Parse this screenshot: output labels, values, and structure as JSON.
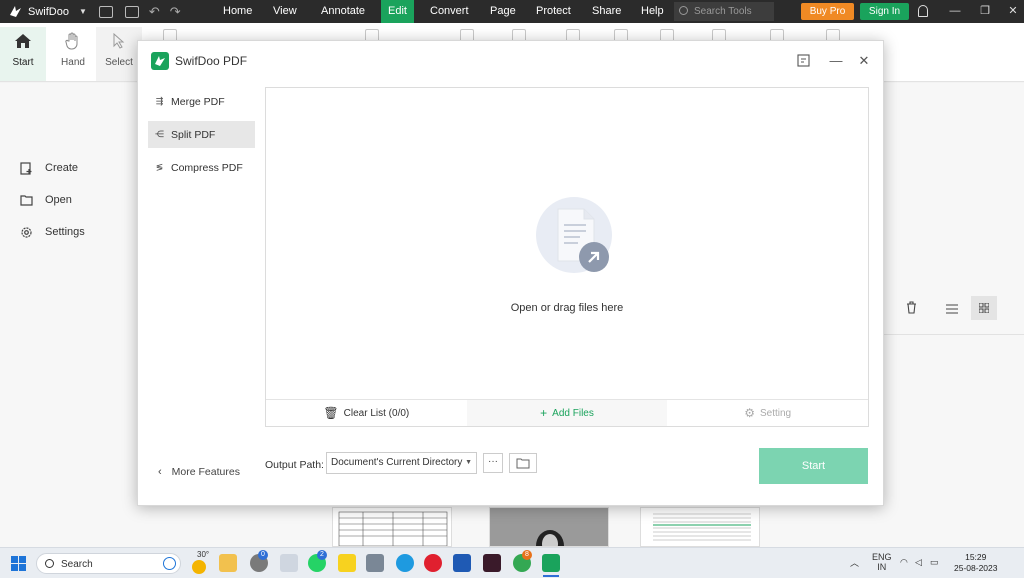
{
  "titlebar": {
    "app_name": "SwifDoo",
    "menus": [
      "Home",
      "View",
      "Annotate",
      "Edit",
      "Convert",
      "Page",
      "Protect",
      "Share",
      "Help"
    ],
    "active_menu": "Edit",
    "search_placeholder": "Search Tools",
    "buy_pro": "Buy Pro",
    "sign_in": "Sign In",
    "accent_green": "#1aa35c",
    "accent_orange": "#f08a24"
  },
  "ribbon": {
    "start": "Start",
    "hand": "Hand",
    "select": "Select"
  },
  "sidebar": {
    "items": [
      "Create",
      "Open",
      "Settings"
    ]
  },
  "dialog": {
    "title": "SwifDoo PDF",
    "nav": [
      "Merge PDF",
      "Split PDF",
      "Compress PDF"
    ],
    "active_nav": "Split PDF",
    "more_features": "More Features",
    "dropzone_text": "Open or drag files here",
    "clear_list": "Clear List (0/0)",
    "add_files": "Add Files",
    "setting": "Setting",
    "output_label": "Output Path:",
    "output_value": "Document's Current Directory",
    "more_btn": "···",
    "start": "Start",
    "start_color": "#7cd4b1"
  },
  "taskbar": {
    "search": "Search",
    "weather": "30°",
    "badges": {
      "app3": "0",
      "whatsapp": "2",
      "chrome": "8"
    },
    "lang_top": "ENG",
    "lang_bottom": "IN",
    "time": "15:29",
    "date": "25-08-2023"
  }
}
